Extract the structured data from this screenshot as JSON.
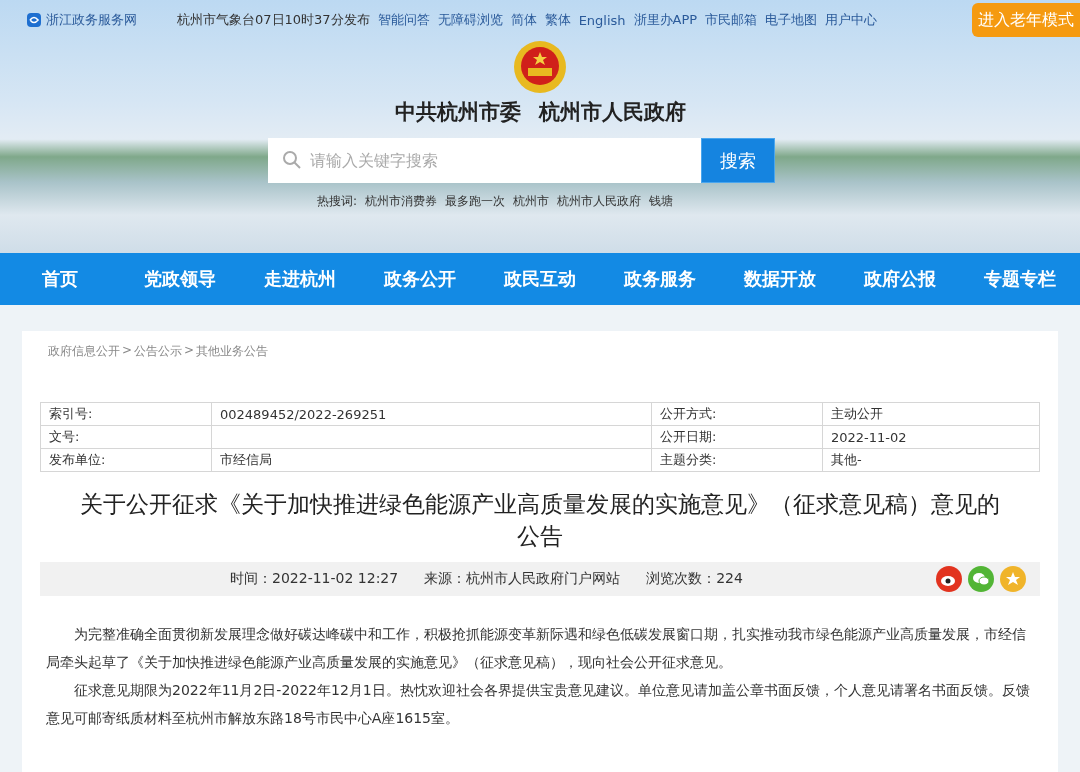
{
  "top_bar": {
    "site_name": "浙江政务服务网",
    "weather": "杭州市气象台07日10时37分发布",
    "links": [
      "智能问答",
      "无障碍浏览",
      "简体",
      "繁体",
      "English",
      "浙里办APP",
      "市民邮箱",
      "电子地图",
      "用户中心"
    ],
    "elder_mode_button": "进入老年模式"
  },
  "header": {
    "titles": [
      "中共杭州市委",
      "杭州市人民政府"
    ],
    "search": {
      "placeholder": "请输入关键字搜索",
      "button": "搜索"
    },
    "hot_words_label": "热搜词:",
    "hot_words": [
      "杭州市消费券",
      "最多跑一次",
      "杭州市",
      "杭州市人民政府",
      "钱塘"
    ]
  },
  "nav": [
    {
      "label": "首页"
    },
    {
      "label": "党政领导"
    },
    {
      "label": "走进杭州"
    },
    {
      "label": "政务公开"
    },
    {
      "label": "政民互动"
    },
    {
      "label": "政务服务"
    },
    {
      "label": "数据开放"
    },
    {
      "label": "政府公报"
    },
    {
      "label": "专题专栏"
    }
  ],
  "breadcrumb": [
    "政府信息公开",
    "公告公示",
    "其他业务公告"
  ],
  "breadcrumb_separator": ">",
  "info_table": [
    {
      "label": "索引号:",
      "value": "002489452/2022-269251",
      "label_2": "公开方式:",
      "value_2": "主动公开"
    },
    {
      "label": "文号:",
      "label_2": "公开日期:",
      "value_2": "2022-11-02"
    },
    {
      "label": "发布单位:",
      "value": "市经信局",
      "label_2": "主题分类:",
      "value_2": "其他-"
    }
  ],
  "article": {
    "title": "关于公开征求《关于加快推进绿色能源产业高质量发展的实施意见》（征求意见稿）意见的公告",
    "meta": {
      "time": "时间：2022-11-02 12:27",
      "source": "来源：杭州市人民政府门户网站",
      "views": "浏览次数：224"
    },
    "paragraphs": [
      "为完整准确全面贯彻新发展理念做好碳达峰碳中和工作，积极抢抓能源变革新际遇和绿色低碳发展窗口期，扎实推动我市绿色能源产业高质量发展，市经信局牵头起草了《关于加快推进绿色能源产业高质量发展的实施意见》（征求意见稿），现向社会公开征求意见。",
      "征求意见期限为2022年11月2日-2022年12月1日。热忱欢迎社会各界提供宝贵意见建议。单位意见请加盖公章书面反馈，个人意见请署名书面反馈。反馈意见可邮寄纸质材料至杭州市解放东路18号市民中心A座1615室。"
    ]
  }
}
